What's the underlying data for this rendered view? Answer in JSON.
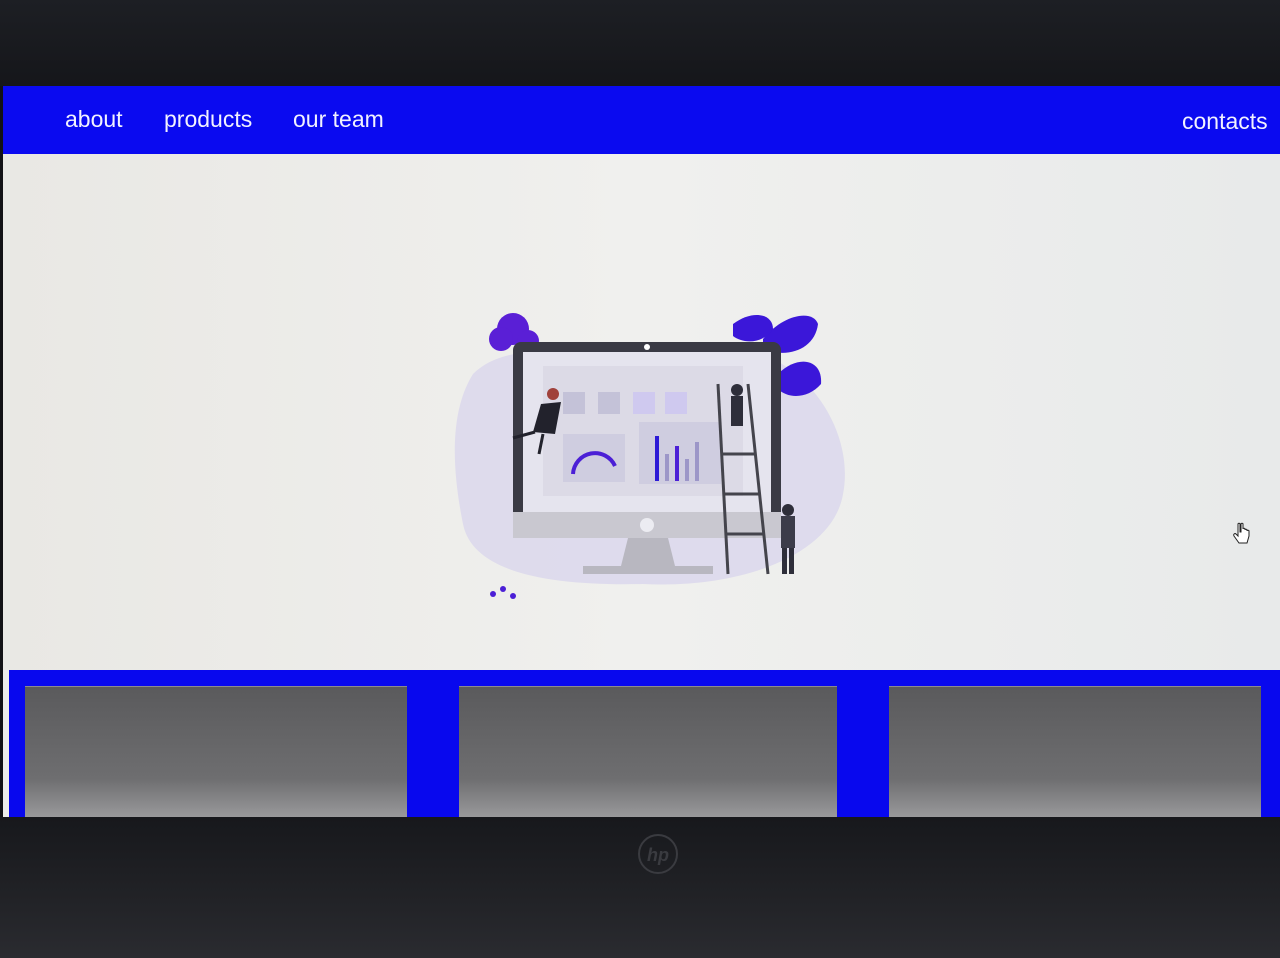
{
  "nav": {
    "items": [
      {
        "label": "about"
      },
      {
        "label": "products"
      },
      {
        "label": "our team"
      }
    ],
    "contacts_label": "contacts"
  },
  "colors": {
    "accent": "#0a0af0",
    "hero_background": "#ececea",
    "card": "#606062",
    "bezel": "#15161a"
  },
  "hero": {
    "image": "dashboard-illustration"
  },
  "cards": {
    "count": 3
  },
  "bezel": {
    "logo": "hp-logo-icon"
  }
}
